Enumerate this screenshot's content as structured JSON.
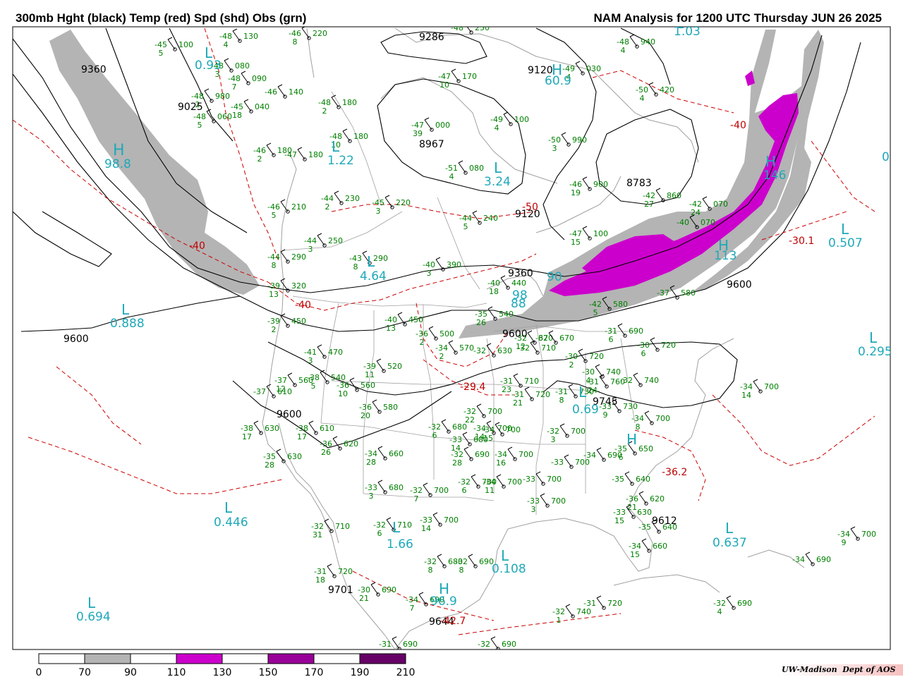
{
  "header": {
    "left_title": "300mb Hght (black) Temp (red) Spd (shd) Obs (grn)",
    "right_title": "NAM Analysis for 1200 UTC Thursday  JUN 26 2025"
  },
  "credit": {
    "org": "UW-Madison",
    "dept": "Dept of AOS"
  },
  "colorbar": {
    "ticks": [
      "0",
      "70",
      "90",
      "110",
      "130",
      "150",
      "170",
      "190",
      "210"
    ],
    "colors": [
      "#ffffff",
      "#b4b4b4",
      "#ffffff",
      "#cc00cc",
      "#ffffff",
      "#990099",
      "#ffffff",
      "#660066"
    ]
  },
  "colors": {
    "height": "#000000",
    "temp": "#cc0000",
    "speed_90_110": "#b4b4b4",
    "speed_110_130": "#cc00cc",
    "obs": "#008000",
    "pressure_centers": "#1fa9b8",
    "land": "#a0a0a0"
  },
  "height_labels": [
    {
      "text": "9360",
      "id": "h-9360-nw"
    },
    {
      "text": "9025",
      "id": "h-9025"
    },
    {
      "text": "9286",
      "id": "h-9286"
    },
    {
      "text": "9120",
      "id": "h-9120-n"
    },
    {
      "text": "8967",
      "id": "h-8967"
    },
    {
      "text": "8783",
      "id": "h-8783"
    },
    {
      "text": "9120",
      "id": "h-9120-c"
    },
    {
      "text": "9360",
      "id": "h-9360-c"
    },
    {
      "text": "9600",
      "id": "h-9600-ne"
    },
    {
      "text": "9600",
      "id": "h-9600-w"
    },
    {
      "text": "9600",
      "id": "h-9600-c"
    },
    {
      "text": "9600",
      "id": "h-9600-sw"
    },
    {
      "text": "9745",
      "id": "h-9745"
    },
    {
      "text": "9612",
      "id": "h-9612"
    },
    {
      "text": "9701",
      "id": "h-9701"
    },
    {
      "text": "9644",
      "id": "h-9644"
    }
  ],
  "temp_labels": [
    {
      "text": "-40",
      "id": "t-40-w"
    },
    {
      "text": "-40",
      "id": "t-40-c"
    },
    {
      "text": "-40",
      "id": "t-40-ne"
    },
    {
      "text": "-50",
      "id": "t-50"
    },
    {
      "text": "-29.4",
      "id": "t-294"
    },
    {
      "text": "-30.1",
      "id": "t-301"
    },
    {
      "text": "-36.2",
      "id": "t-362"
    },
    {
      "text": "-42.7",
      "id": "t-427"
    }
  ],
  "centers": [
    {
      "type": "H",
      "value": "98.8",
      "id": "c1"
    },
    {
      "type": "L",
      "value": "0.93",
      "id": "c2"
    },
    {
      "type": "L",
      "value": "1.22",
      "id": "c3"
    },
    {
      "type": "L",
      "value": "3.24",
      "id": "c4"
    },
    {
      "type": "H",
      "value": "60.9",
      "id": "c5"
    },
    {
      "type": "L",
      "value": "1.03",
      "id": "c6"
    },
    {
      "type": "L",
      "value": "4.64",
      "id": "c7"
    },
    {
      "type": "L",
      "value": "0.888",
      "id": "c8"
    },
    {
      "type": "H",
      "value": "146",
      "id": "c9"
    },
    {
      "type": "H",
      "value": "113",
      "id": "c10"
    },
    {
      "type": "L",
      "value": "0.507",
      "id": "c11"
    },
    {
      "type": "L",
      "value": "0.295",
      "id": "c12"
    },
    {
      "type": "L",
      "value": "0.69",
      "id": "c13"
    },
    {
      "type": "L",
      "value": "0.446",
      "id": "c14"
    },
    {
      "type": "L",
      "value": "1.66",
      "id": "c15"
    },
    {
      "type": "L",
      "value": "0.108",
      "id": "c16"
    },
    {
      "type": "L",
      "value": "0.637",
      "id": "c17"
    },
    {
      "type": "L",
      "value": "0.694",
      "id": "c18"
    },
    {
      "type": "H",
      "value": "96.9",
      "id": "c19"
    },
    {
      "type": "H",
      "value": "",
      "id": "c20"
    },
    {
      "type": "",
      "value": "90",
      "id": "c21"
    },
    {
      "type": "",
      "value": "88",
      "id": "c22"
    },
    {
      "type": "",
      "value": "98",
      "id": "c23"
    },
    {
      "type": "",
      "value": "0",
      "id": "c24"
    }
  ],
  "observations": [
    {
      "t": "-45",
      "h": "100",
      "d": "5"
    },
    {
      "t": "-48",
      "h": "130",
      "d": "4"
    },
    {
      "t": "-46",
      "h": "220",
      "d": "8"
    },
    {
      "t": "-48",
      "h": "250",
      "d": ""
    },
    {
      "t": "-48",
      "h": "080",
      "d": "3"
    },
    {
      "t": "-48",
      "h": "090",
      "d": "7"
    },
    {
      "t": "-46",
      "h": "140",
      "d": ""
    },
    {
      "t": "-48",
      "h": "980",
      "d": "2"
    },
    {
      "t": "-45",
      "h": "040",
      "d": "18"
    },
    {
      "t": "-48",
      "h": "060",
      "d": "5"
    },
    {
      "t": "-48",
      "h": "180",
      "d": "2"
    },
    {
      "t": "-47",
      "h": "170",
      "d": "10"
    },
    {
      "t": "-49",
      "h": "030",
      "d": "4"
    },
    {
      "t": "-48",
      "h": "940",
      "d": "4"
    },
    {
      "t": "-50",
      "h": "420",
      "d": "4"
    },
    {
      "t": "-47",
      "h": "000",
      "d": "39"
    },
    {
      "t": "-49",
      "h": "100",
      "d": "4"
    },
    {
      "t": "-50",
      "h": "990",
      "d": "3"
    },
    {
      "t": "-48",
      "h": "180",
      "d": "10"
    },
    {
      "t": "-46",
      "h": "180",
      "d": "2"
    },
    {
      "t": "-47",
      "h": "180",
      "d": ""
    },
    {
      "t": "-51",
      "h": "080",
      "d": "4"
    },
    {
      "t": "-46",
      "h": "900",
      "d": "19"
    },
    {
      "t": "-42",
      "h": "860",
      "d": "27"
    },
    {
      "t": "-42",
      "h": "070",
      "d": "24"
    },
    {
      "t": "-46",
      "h": "210",
      "d": "5"
    },
    {
      "t": "-44",
      "h": "230",
      "d": "2"
    },
    {
      "t": "-45",
      "h": "220",
      "d": "3"
    },
    {
      "t": "-44",
      "h": "240",
      "d": "5"
    },
    {
      "t": "-47",
      "h": "100",
      "d": "15"
    },
    {
      "t": "-40",
      "h": "070",
      "d": ""
    },
    {
      "t": "-44",
      "h": "250",
      "d": "3"
    },
    {
      "t": "-43",
      "h": "290",
      "d": "8"
    },
    {
      "t": "-44",
      "h": "290",
      "d": "8"
    },
    {
      "t": "-40",
      "h": "390",
      "d": "3"
    },
    {
      "t": "-40",
      "h": "440",
      "d": "18"
    },
    {
      "t": "-39",
      "h": "320",
      "d": "13"
    },
    {
      "t": "-39",
      "h": "450",
      "d": "2"
    },
    {
      "t": "-40",
      "h": "450",
      "d": "13"
    },
    {
      "t": "-35",
      "h": "540",
      "d": "26"
    },
    {
      "t": "-42",
      "h": "580",
      "d": "5"
    },
    {
      "t": "-37",
      "h": "580",
      "d": ""
    },
    {
      "t": "-36",
      "h": "500",
      "d": "2"
    },
    {
      "t": "-34",
      "h": "570",
      "d": "2"
    },
    {
      "t": "-41",
      "h": "470",
      "d": "3"
    },
    {
      "t": "-32",
      "h": "630",
      "d": ""
    },
    {
      "t": "-32",
      "h": "670",
      "d": "12"
    },
    {
      "t": "-32",
      "h": "670",
      "d": ""
    },
    {
      "t": "-31",
      "h": "690",
      "d": "6"
    },
    {
      "t": "-30",
      "h": "720",
      "d": "6"
    },
    {
      "t": "-32",
      "h": "710",
      "d": ""
    },
    {
      "t": "-39",
      "h": "520",
      "d": "11"
    },
    {
      "t": "-37",
      "h": "560",
      "d": "12"
    },
    {
      "t": "-38",
      "h": "540",
      "d": "5"
    },
    {
      "t": "-36",
      "h": "560",
      "d": "10"
    },
    {
      "t": "-30",
      "h": "720",
      "d": "2"
    },
    {
      "t": "-30",
      "h": "740",
      "d": "4"
    },
    {
      "t": "-31",
      "h": "760",
      "d": "24"
    },
    {
      "t": "-32",
      "h": "740",
      "d": ""
    },
    {
      "t": "-31",
      "h": "710",
      "d": "23"
    },
    {
      "t": "-31",
      "h": "720",
      "d": "21"
    },
    {
      "t": "-31",
      "h": "730",
      "d": "8"
    },
    {
      "t": "-33",
      "h": "730",
      "d": "9"
    },
    {
      "t": "-34",
      "h": "700",
      "d": "8"
    },
    {
      "t": "-37",
      "h": "610",
      "d": ""
    },
    {
      "t": "-36",
      "h": "580",
      "d": "20"
    },
    {
      "t": "-34",
      "h": "700",
      "d": "14"
    },
    {
      "t": "-38",
      "h": "630",
      "d": "17"
    },
    {
      "t": "-38",
      "h": "610",
      "d": "17"
    },
    {
      "t": "-32",
      "h": "700",
      "d": "22"
    },
    {
      "t": "-32",
      "h": "680",
      "d": "6"
    },
    {
      "t": "-34",
      "h": "700",
      "d": "15"
    },
    {
      "t": "-32",
      "h": "700",
      "d": "3"
    },
    {
      "t": "-36",
      "h": "620",
      "d": "26"
    },
    {
      "t": "-33",
      "h": "680",
      "d": "14"
    },
    {
      "t": "-35",
      "h": "630",
      "d": "28"
    },
    {
      "t": "-34",
      "h": "660",
      "d": "28"
    },
    {
      "t": "-32",
      "h": "690",
      "d": "28"
    },
    {
      "t": "-34",
      "h": "700",
      "d": "16"
    },
    {
      "t": "-33",
      "h": "700",
      "d": ""
    },
    {
      "t": "-34",
      "h": "690",
      "d": ""
    },
    {
      "t": "-35",
      "h": "650",
      "d": "6"
    },
    {
      "t": "-35",
      "h": "640",
      "d": ""
    },
    {
      "t": "-36",
      "h": "620",
      "d": "21"
    },
    {
      "t": "-33",
      "h": "680",
      "d": "3"
    },
    {
      "t": "-32",
      "h": "700",
      "d": "7"
    },
    {
      "t": "-32",
      "h": "700",
      "d": "6"
    },
    {
      "t": "-34",
      "h": "700",
      "d": "11"
    },
    {
      "t": "-33",
      "h": "700",
      "d": ""
    },
    {
      "t": "-33",
      "h": "700",
      "d": "3"
    },
    {
      "t": "-33",
      "h": "630",
      "d": "15"
    },
    {
      "t": "-35",
      "h": "640",
      "d": ""
    },
    {
      "t": "-34",
      "h": "660",
      "d": "15"
    },
    {
      "t": "-32",
      "h": "710",
      "d": "31"
    },
    {
      "t": "-32",
      "h": "710",
      "d": "6"
    },
    {
      "t": "-33",
      "h": "700",
      "d": "14"
    },
    {
      "t": "-32",
      "h": "680",
      "d": "8"
    },
    {
      "t": "-32",
      "h": "690",
      "d": "8"
    },
    {
      "t": "-31",
      "h": "720",
      "d": "18"
    },
    {
      "t": "-30",
      "h": "690",
      "d": "21"
    },
    {
      "t": "-34",
      "h": "690",
      "d": "7"
    },
    {
      "t": "-32",
      "h": "740",
      "d": "1"
    },
    {
      "t": "-31",
      "h": "720",
      "d": ""
    },
    {
      "t": "-32",
      "h": "690",
      "d": "4"
    },
    {
      "t": "-34",
      "h": "700",
      "d": "14"
    },
    {
      "t": "-34",
      "h": "700",
      "d": "9"
    },
    {
      "t": "-34",
      "h": "690",
      "d": ""
    },
    {
      "t": "-31",
      "h": "690",
      "d": ""
    },
    {
      "t": "-32",
      "h": "690",
      "d": ""
    }
  ]
}
